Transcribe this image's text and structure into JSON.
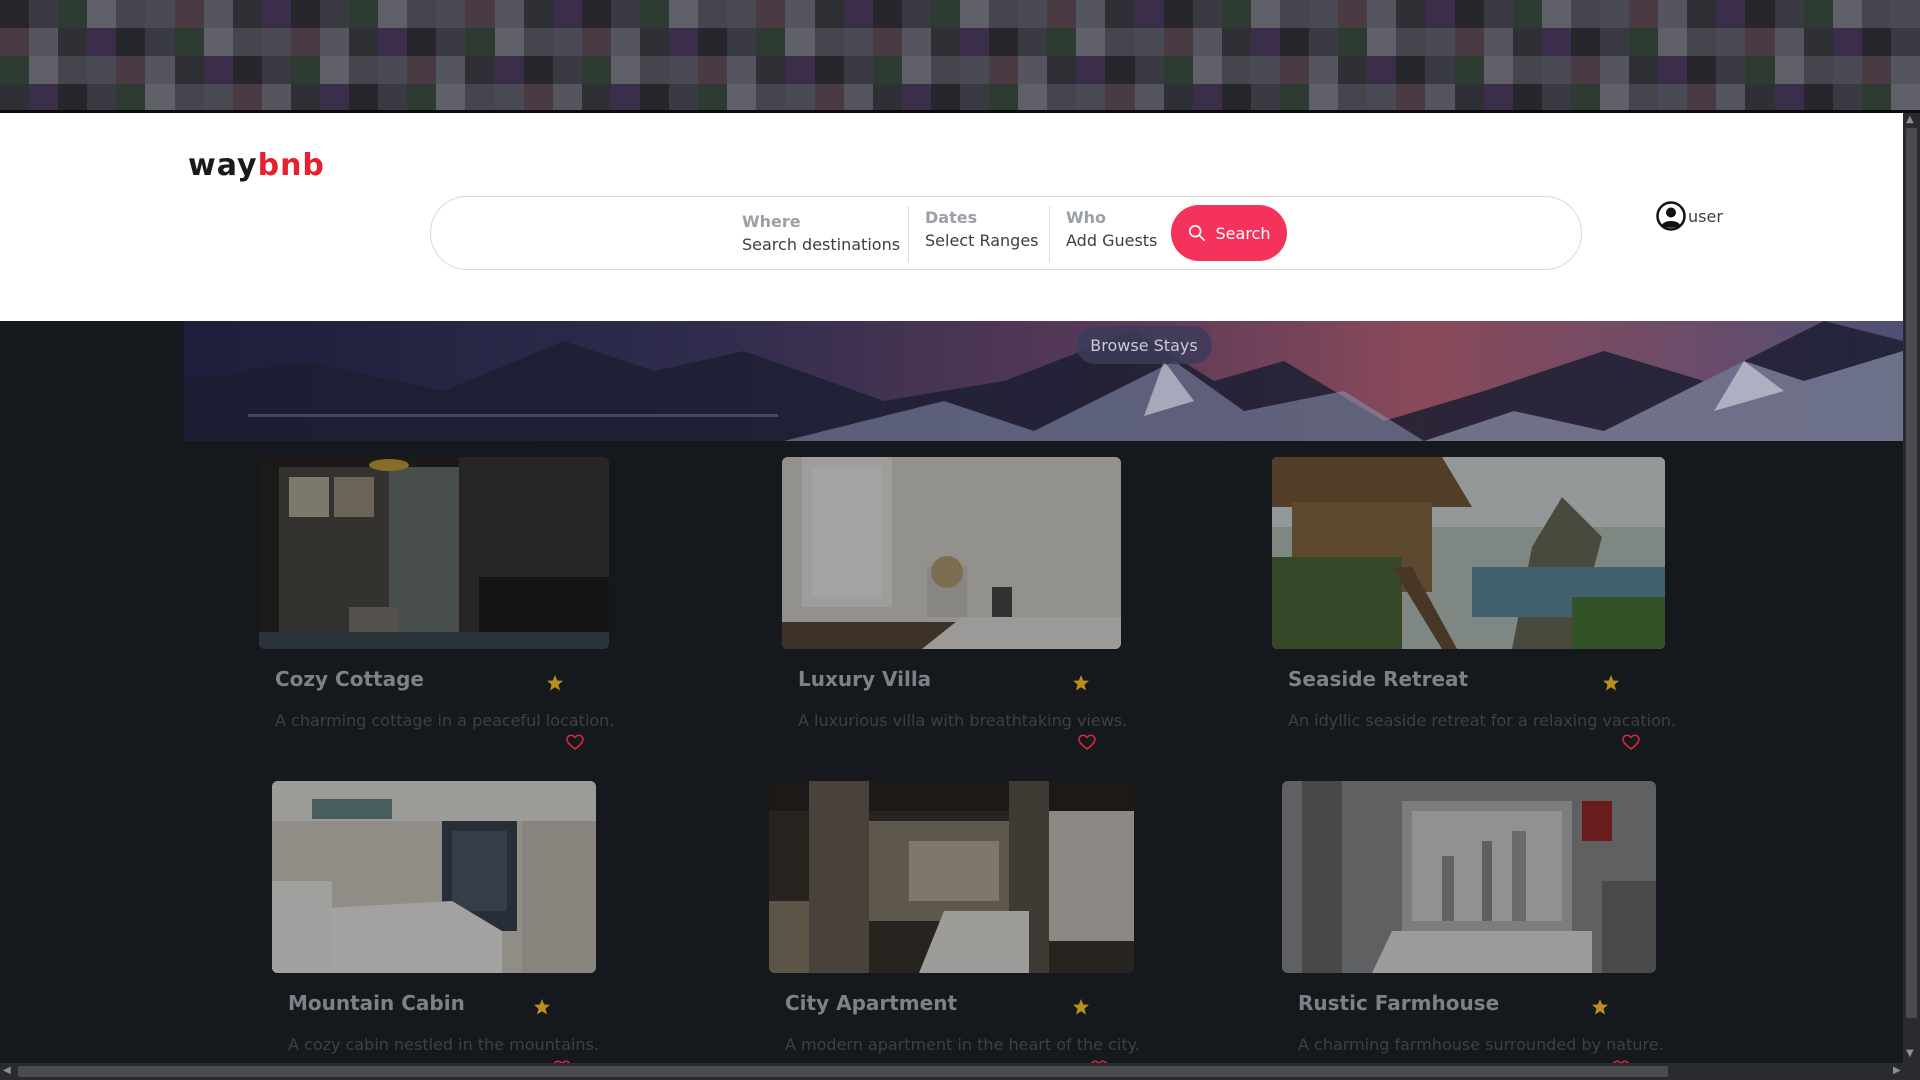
{
  "brand": {
    "logo_left": "way",
    "logo_right": "bnb",
    "accent": "#f4325b"
  },
  "search": {
    "where_label": "Where",
    "where_value": "Search destinations",
    "dates_label": "Dates",
    "dates_value": "Select Ranges",
    "who_label": "Who",
    "who_value": "Add Guests",
    "button_label": "Search",
    "button_icon": "search-icon"
  },
  "user": {
    "label": "user",
    "icon": "user-circle-icon"
  },
  "hero": {
    "browse_label": "Browse Stays"
  },
  "listings": [
    {
      "title": "Cozy Cottage",
      "description": "A charming cottage in a peaceful location."
    },
    {
      "title": "Luxury Villa",
      "description": "A luxurious villa with breathtaking views."
    },
    {
      "title": "Seaside Retreat",
      "description": "An idyllic seaside retreat for a relaxing vacation."
    },
    {
      "title": "Mountain Cabin",
      "description": "A cozy cabin nestled in the mountains."
    },
    {
      "title": "City Apartment",
      "description": "A modern apartment in the heart of the city."
    },
    {
      "title": "Rustic Farmhouse",
      "description": "A charming farmhouse surrounded by nature."
    }
  ],
  "colors": {
    "star": "#b8901a",
    "heart": "#e0243f",
    "page_bg": "#15181d"
  }
}
